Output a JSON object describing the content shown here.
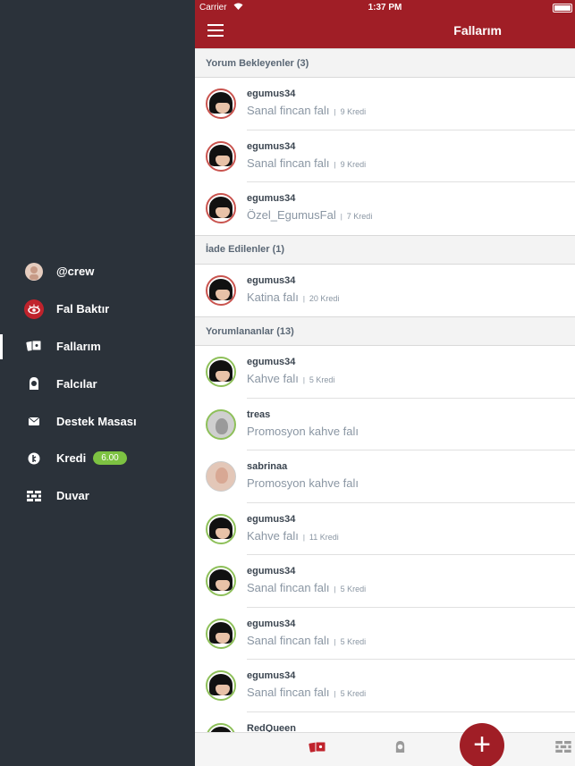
{
  "status": {
    "carrier": "Carrier",
    "time": "1:37 PM"
  },
  "header": {
    "title": "Fallarım"
  },
  "sidebar": {
    "items": [
      {
        "label": "@crew"
      },
      {
        "label": "Fal Baktır"
      },
      {
        "label": "Fallarım"
      },
      {
        "label": "Falcılar"
      },
      {
        "label": "Destek Masası"
      },
      {
        "label": "Kredi",
        "badge": "6.00"
      },
      {
        "label": "Duvar"
      }
    ]
  },
  "sections": [
    {
      "title": "Yorum Bekleyenler  (3)"
    },
    {
      "title": "İade Edilenler  (1)"
    },
    {
      "title": "Yorumlananlar  (13)"
    }
  ],
  "rows": [
    {
      "user": "egumus34",
      "desc": "Sanal fincan falı",
      "credit": "9 Kredi"
    },
    {
      "user": "egumus34",
      "desc": "Sanal fincan falı",
      "credit": "9 Kredi"
    },
    {
      "user": "egumus34",
      "desc": "Özel_EgumusFal",
      "credit": "7 Kredi"
    },
    {
      "user": "egumus34",
      "desc": "Katina falı",
      "credit": "20 Kredi"
    },
    {
      "user": "egumus34",
      "desc": "Kahve falı",
      "credit": "5 Kredi"
    },
    {
      "user": "treas",
      "desc": "Promosyon kahve falı"
    },
    {
      "user": "sabrinaa",
      "desc": "Promosyon kahve falı"
    },
    {
      "user": "egumus34",
      "desc": "Kahve falı",
      "credit": "11 Kredi"
    },
    {
      "user": "egumus34",
      "desc": "Sanal fincan falı",
      "credit": "5 Kredi"
    },
    {
      "user": "egumus34",
      "desc": "Sanal fincan falı",
      "credit": "5 Kredi"
    },
    {
      "user": "egumus34",
      "desc": "Sanal fincan falı",
      "credit": "5 Kredi"
    },
    {
      "user": "RedQueen"
    }
  ],
  "bottom": {
    "fab": "+"
  },
  "colors": {
    "brand": "#a01e26",
    "sidebar": "#2b323a",
    "badge": "#7dc242"
  }
}
